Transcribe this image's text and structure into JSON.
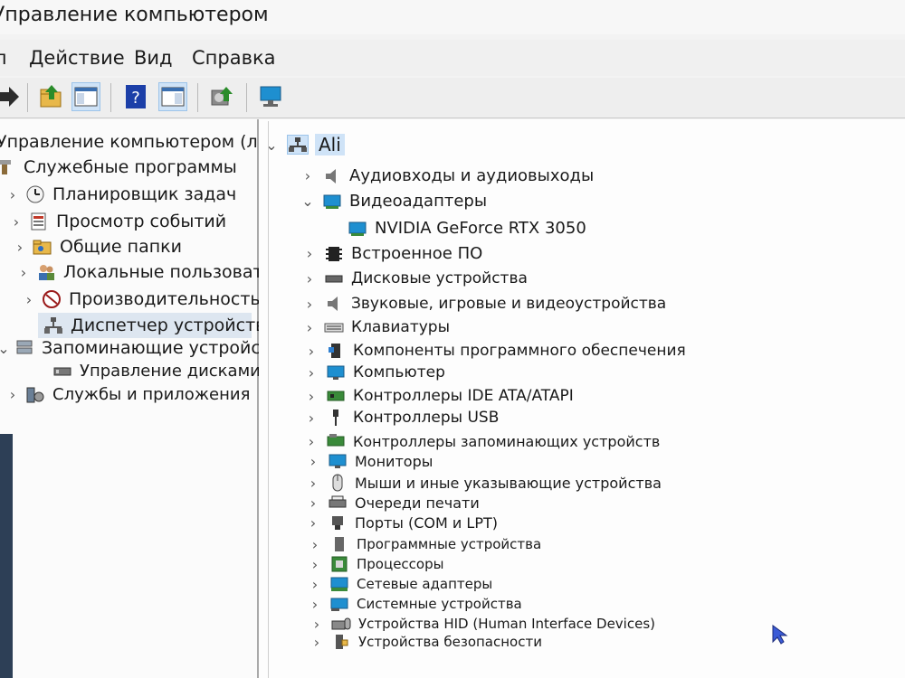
{
  "window": {
    "title": "Управление компьютером"
  },
  "menu": {
    "action": "Действие",
    "view": "Вид",
    "help": "Справка"
  },
  "left_tree": {
    "root": "Управление компьютером (л",
    "system_tools": "Служебные программы",
    "items": [
      "Планировщик задач",
      "Просмотр событий",
      "Общие папки",
      "Локальные пользовате",
      "Производительность",
      "Диспетчер устройств"
    ],
    "storage": "Запоминающие устройст",
    "disk_management": "Управление дисками",
    "services": "Службы и приложения"
  },
  "device_tree": {
    "computer_name": "Ali",
    "categories": [
      "Аудиовходы и аудиовыходы",
      "Видеоадаптеры",
      "NVIDIA GeForce RTX 3050",
      "Встроенное ПО",
      "Дисковые устройства",
      "Звуковые, игровые и видеоустройства",
      "Клавиатуры",
      "Компоненты программного обеспечения",
      "Компьютер",
      "Контроллеры IDE ATA/ATAPI",
      "Контроллеры USB",
      "Контроллеры запоминающих устройств",
      "Мониторы",
      "Мыши и иные указывающие устройства",
      "Очереди печати",
      "Порты (COM и LPT)",
      "Программные устройства",
      "Процессоры",
      "Сетевые адаптеры",
      "Системные устройства",
      "Устройства HID (Human Interface Devices)",
      "Устройства безопасности"
    ]
  },
  "colors": {
    "accent": "#cfe3f7",
    "selection": "#dde6f0"
  }
}
